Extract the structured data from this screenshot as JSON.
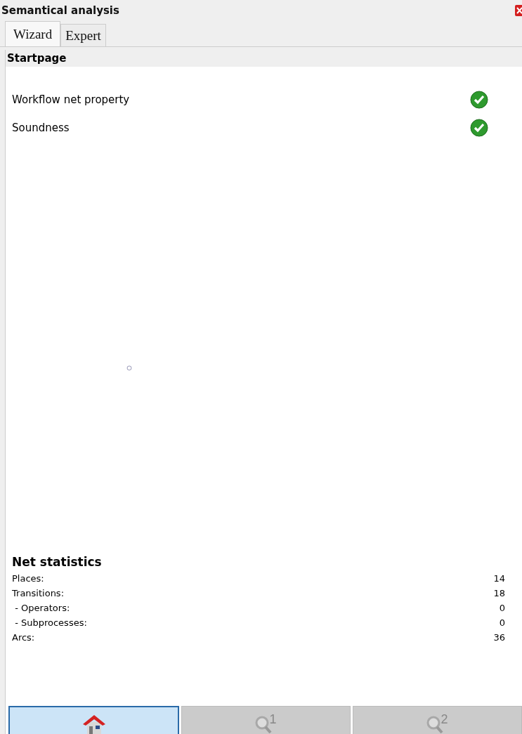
{
  "window": {
    "title": "Semantical analysis"
  },
  "tabs": [
    {
      "label": "Wizard",
      "selected": true
    },
    {
      "label": "Expert",
      "selected": false
    }
  ],
  "page": {
    "header": "Startpage"
  },
  "checks": [
    {
      "label": "Workflow net property",
      "passed": true
    },
    {
      "label": "Soundness",
      "passed": true
    }
  ],
  "statistics": {
    "title": "Net statistics",
    "rows": [
      {
        "label": "Places:",
        "value": "14"
      },
      {
        "label": "Transitions:",
        "value": "18"
      },
      {
        "label": " - Operators:",
        "value": "0"
      },
      {
        "label": " - Subprocesses:",
        "value": "0"
      },
      {
        "label": "Arcs:",
        "value": "36"
      }
    ]
  },
  "nav_buttons": [
    {
      "kind": "home",
      "selected": true
    },
    {
      "kind": "search",
      "label": "1",
      "selected": false
    },
    {
      "kind": "search",
      "label": "2",
      "selected": false
    }
  ]
}
